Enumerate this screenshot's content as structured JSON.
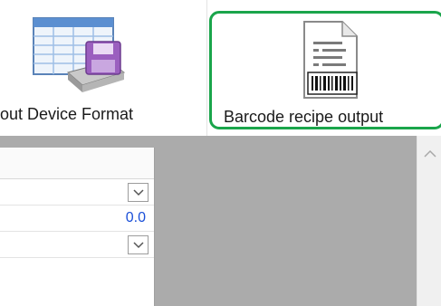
{
  "toolbar": {
    "device_format_label": "out Device Format",
    "barcode_output_label": "Barcode recipe output",
    "highlight_color": "#1aa54b",
    "icons": [
      "database-table-icon",
      "barcode-document-icon"
    ]
  },
  "grid": {
    "rows": [
      {
        "type": "dropdown",
        "value": ""
      },
      {
        "type": "number",
        "value": "0.0"
      },
      {
        "type": "dropdown",
        "value": ""
      }
    ],
    "value_color": "#1a4fd8"
  }
}
